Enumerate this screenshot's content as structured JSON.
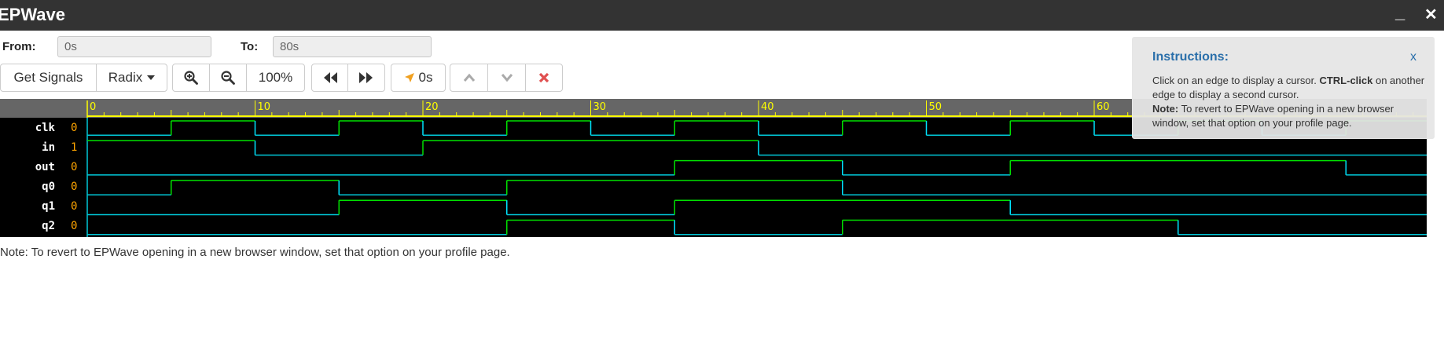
{
  "window": {
    "title": "EPWave",
    "minimize_label": "_",
    "close_label": "✕"
  },
  "range": {
    "from_label": "From:",
    "from_value": "0s",
    "to_label": "To:",
    "to_value": "80s"
  },
  "toolbar": {
    "get_signals_label": "Get Signals",
    "radix_label": "Radix",
    "zoom_in_icon": "zoom-in-icon",
    "zoom_out_icon": "zoom-out-icon",
    "zoom_level": "100%",
    "prev_edge_icon": "fast-backward-icon",
    "next_edge_icon": "fast-forward-icon",
    "cursor_time": "0s",
    "cursor_icon": "location-arrow-icon",
    "up_icon": "chevron-up-icon",
    "down_icon": "chevron-down-icon",
    "remove_icon": "red-x-icon"
  },
  "ruler": {
    "labels": [
      "0",
      "10",
      "20",
      "30",
      "40",
      "50",
      "60"
    ]
  },
  "signals": [
    {
      "name": "clk",
      "value": "0"
    },
    {
      "name": "in",
      "value": "1"
    },
    {
      "name": "out",
      "value": "0"
    },
    {
      "name": "q0",
      "value": "0"
    },
    {
      "name": "q1",
      "value": "0"
    },
    {
      "name": "q2",
      "value": "0"
    }
  ],
  "waves": {
    "time_start": 0,
    "time_end": 80,
    "traces": [
      {
        "name": "clk",
        "init": 0,
        "edges": [
          5,
          10,
          15,
          20,
          25,
          30,
          35,
          40,
          45,
          50,
          55,
          60,
          65,
          70,
          75
        ]
      },
      {
        "name": "in",
        "init": 1,
        "edges": [
          10,
          20,
          40
        ]
      },
      {
        "name": "out",
        "init": 0,
        "edges": [
          35,
          45,
          55,
          75
        ]
      },
      {
        "name": "q0",
        "init": 0,
        "edges": [
          5,
          15,
          25,
          45
        ]
      },
      {
        "name": "q1",
        "init": 0,
        "edges": [
          15,
          25,
          35,
          55
        ]
      },
      {
        "name": "q2",
        "init": 0,
        "edges": [
          25,
          35,
          45,
          65
        ]
      }
    ],
    "colors": {
      "high": "#00e000",
      "low": "#00c8d8",
      "edge_rising": "#00e000",
      "edge_falling": "#00e5ff",
      "ruler_text": "#ffff00",
      "value_text": "#ffa500"
    }
  },
  "note": "Note: To revert to EPWave opening in a new browser window, set that option on your profile page.",
  "instructions": {
    "title": "Instructions:",
    "close": "x",
    "line1_a": "Click on an edge to display a cursor. ",
    "line1_b": "CTRL-click",
    "line1_c": " on another edge to display a second cursor.",
    "note_label": "Note:",
    "note_text": " To revert to EPWave opening in a new browser window, set that option on your profile page."
  }
}
